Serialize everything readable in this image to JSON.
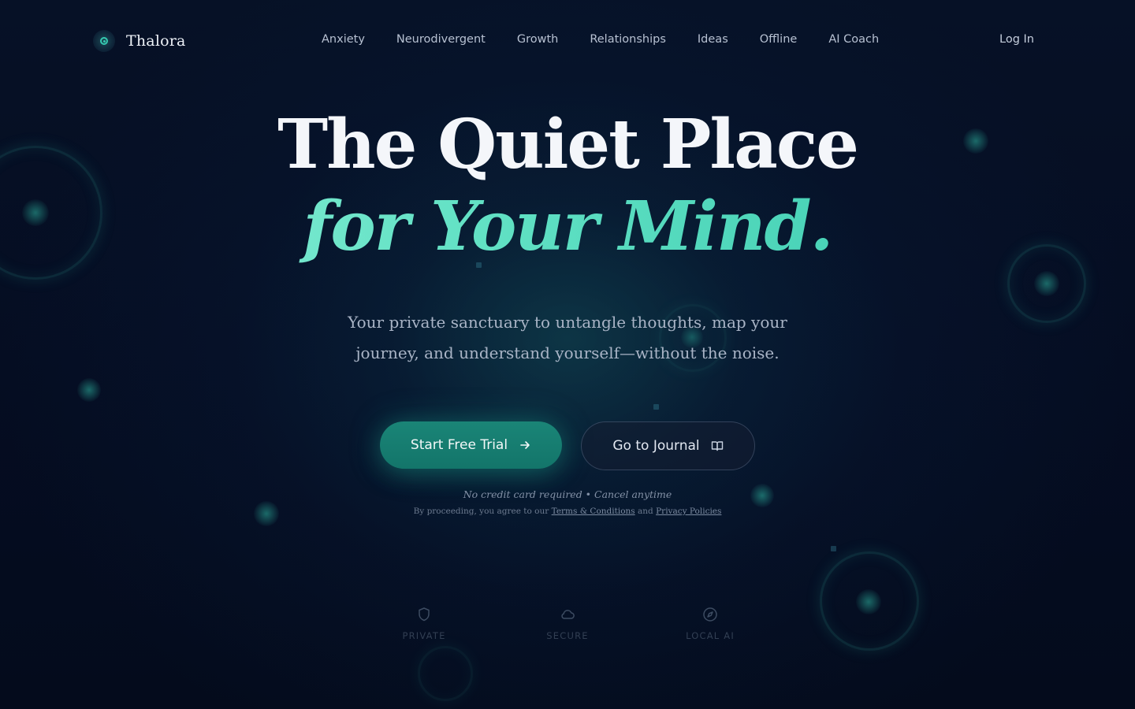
{
  "brand": {
    "name": "Thalora",
    "logo_icon": "orbit-dot-icon",
    "accent": "#35c9b0"
  },
  "nav": {
    "items": [
      {
        "label": "Anxiety"
      },
      {
        "label": "Neurodivergent"
      },
      {
        "label": "Growth"
      },
      {
        "label": "Relationships"
      },
      {
        "label": "Ideas"
      },
      {
        "label": "Offline"
      },
      {
        "label": "AI Coach"
      }
    ],
    "login_label": "Log In"
  },
  "hero": {
    "title_line1": "The Quiet Place",
    "title_line2": "for Your Mind.",
    "subtitle_line1": "Your private sanctuary to untangle thoughts, map your",
    "subtitle_line2": "journey, and understand yourself—without the noise."
  },
  "cta": {
    "primary_label": "Start Free Trial",
    "primary_icon": "arrow-right-icon",
    "secondary_label": "Go to Journal",
    "secondary_icon": "book-open-icon",
    "note": "No credit card required • Cancel anytime",
    "legal_prefix": "By proceeding, you agree to our",
    "terms_label": "Terms & Conditions",
    "legal_and": "and",
    "privacy_label": "Privacy Policies"
  },
  "features": [
    {
      "label": "PRIVATE",
      "icon": "shield-icon"
    },
    {
      "label": "SECURE",
      "icon": "cloud-icon"
    },
    {
      "label": "LOCAL AI",
      "icon": "compass-icon"
    }
  ],
  "colors": {
    "background": "#050d1f",
    "primary_button": "#13756a",
    "title_gradient_start": "#8ff0d9",
    "title_gradient_end": "#36c7ad"
  }
}
